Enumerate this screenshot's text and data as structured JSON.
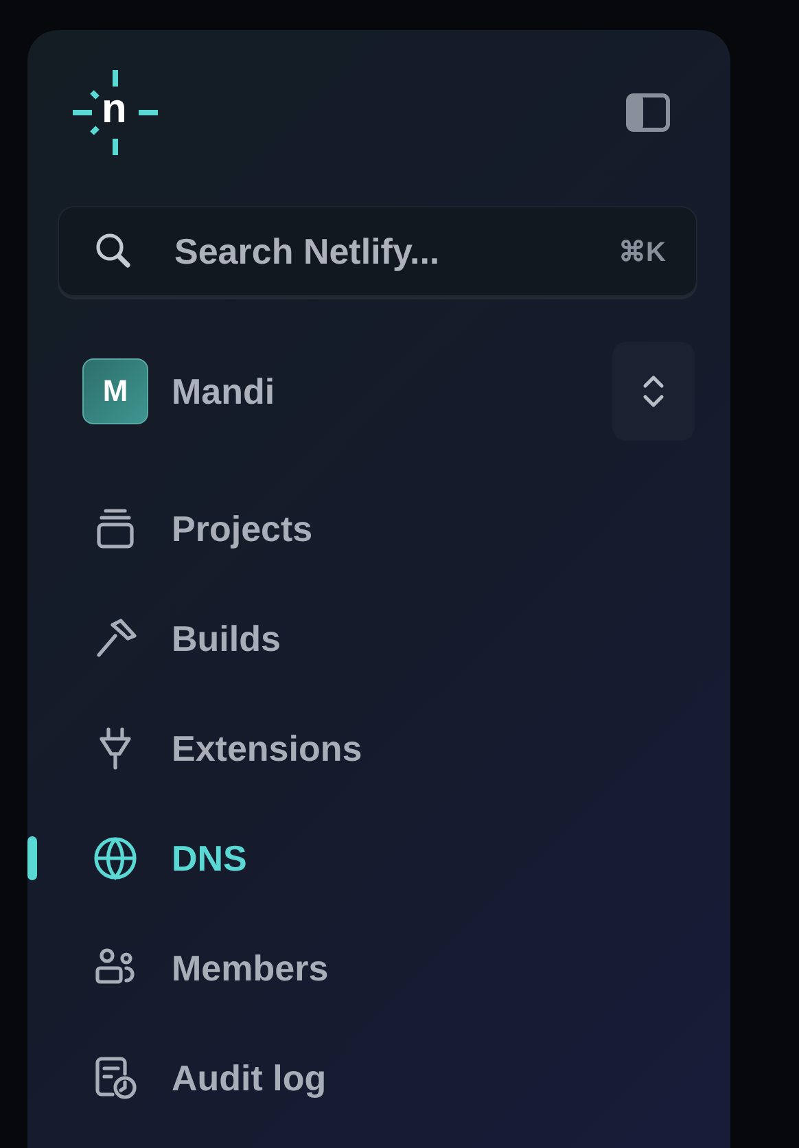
{
  "logo": {
    "letter": "n"
  },
  "search": {
    "placeholder": "Search Netlify...",
    "shortcut": "⌘K"
  },
  "team": {
    "initial": "M",
    "name": "Mandi"
  },
  "nav": [
    {
      "label": "Projects",
      "selected": false
    },
    {
      "label": "Builds",
      "selected": false
    },
    {
      "label": "Extensions",
      "selected": false
    },
    {
      "label": "DNS",
      "selected": true
    },
    {
      "label": "Members",
      "selected": false
    },
    {
      "label": "Audit log",
      "selected": false
    }
  ]
}
